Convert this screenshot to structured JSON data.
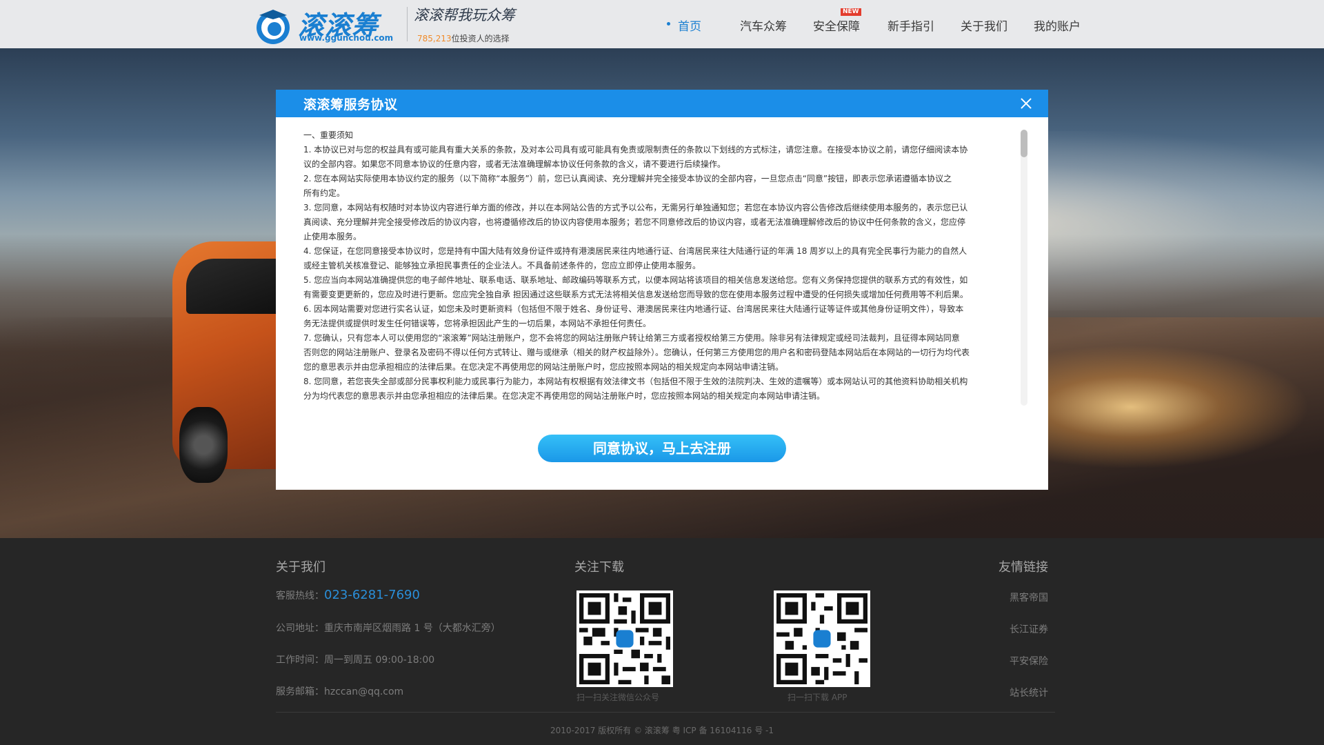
{
  "header": {
    "logo_text": "滚滚筹",
    "logo_url": "www.ggunchou.com",
    "slogan": "滚滚帮我玩众筹",
    "investor_count": "785,213",
    "investor_suffix": "位投资人的选择",
    "nav": [
      {
        "label": "首页",
        "active": true
      },
      {
        "label": "汽车众筹"
      },
      {
        "label": "安全保障",
        "badge": "NEW"
      },
      {
        "label": "新手指引"
      },
      {
        "label": "关于我们"
      },
      {
        "label": "我的账户"
      }
    ]
  },
  "modal": {
    "title": "滚滚筹服务协议",
    "section_title": "一、重要须知",
    "lines": [
      "1. 本协议已对与您的权益具有或可能具有重大关系的条款，及对本公司具有或可能具有免责或限制责任的条款以下划线的方式标注，请您注意。在接受本协议之前，请您仔细阅读本协",
      "议的全部内容。如果您不同意本协议的任意内容，或者无法准确理解本协议任何条款的含义，请不要进行后续操作。",
      "2. 您在本网站实际使用本协议约定的服务（以下简称“本服务”）前，您已认真阅读、充分理解并完全接受本协议的全部内容，一旦您点击“同意”按钮，即表示您承诺遵循本协议之",
      "所有约定。",
      "3. 您同意，本网站有权随时对本协议内容进行单方面的修改，并以在本网站公告的方式予以公布，无需另行单独通知您；若您在本协议内容公告修改后继续使用本服务的，表示您已认",
      "真阅读、充分理解并完全接受修改后的协议内容，也将遵循修改后的协议内容使用本服务；若您不同意修改后的协议内容，或者无法准确理解修改后的协议中任何条款的含义，您应停",
      "止使用本服务。",
      "4. 您保证，在您同意接受本协议时，您是持有中国大陆有效身份证件或持有港澳居民来往内地通行证、台湾居民来往大陆通行证的年满 18 周岁以上的具有完全民事行为能力的自然人",
      "或经主管机关核准登记、能够独立承担民事责任的企业法人。不具备前述条件的，您应立即停止使用本服务。",
      "5. 您应当向本网站准确提供您的电子邮件地址、联系电话、联系地址、邮政编码等联系方式，以便本网站将该项目的相关信息发送给您。您有义务保持您提供的联系方式的有效性，如",
      "有需要变更更新的，您应及时进行更新。您应完全独自承 担因通过这些联系方式无法将相关信息发送给您而导致的您在使用本服务过程中遭受的任何损失或增加任何费用等不利后果。",
      "6. 因本网站需要对您进行实名认证，如您未及时更新资料（包括但不限于姓名、身份证号、港澳居民来往内地通行证、台湾居民来往大陆通行证等证件或其他身份证明文件），导致本",
      "务无法提供或提供时发生任何错误等，您将承担因此产生的一切后果，本网站不承担任何责任。",
      "7. 您确认，只有您本人可以使用您的“滚滚筹”网站注册账户，您不会将您的网站注册账户转让给第三方或者授权给第三方使用。除非另有法律规定或经司法裁判，且征得本网站同意",
      "否则您的网站注册账户、登录名及密码不得以任何方式转让、赠与或继承（相关的财产权益除外）。您确认，任何第三方使用您的用户名和密码登陆本网站后在本网站的一切行为均代表",
      "您的意思表示并由您承担相应的法律后果。在您决定不再使用您的网站注册账户时，您应按照本网站的相关规定向本网站申请注销。",
      "8. 您同意，若您丧失全部或部分民事权利能力或民事行为能力，本网站有权根据有效法律文书（包括但不限于生效的法院判决、生效的遗嘱等）或本网站认可的其他资料协助相关机构",
      "分为均代表您的意思表示并由您承担相应的法律后果。在您决定不再使用您的网站注册账户时，您应按照本网站的相关规定向本网站申请注销。"
    ],
    "agree_button": "同意协议，马上去注册"
  },
  "footer": {
    "about": {
      "title": "关于我们",
      "hotline_label": "客服热线：",
      "hotline": "023-6281-7690",
      "address": "公司地址：重庆市南岸区烟雨路 1 号（大都水汇旁）",
      "hours": "工作时间：周一到周五  09:00-18:00",
      "email": "服务邮箱：hzccan@qq.com"
    },
    "download": {
      "title": "关注下载",
      "qr1_caption": "扫一扫关注微信公众号",
      "qr2_caption": "扫一扫下载 APP"
    },
    "links": {
      "title": "友情链接",
      "items": [
        "黑客帝国",
        "长江证券",
        "平安保险",
        "站长统计"
      ]
    },
    "copyright": "2010-2017 版权所有 © 滚滚筹 粤 ICP 备 16104116 号 -1"
  },
  "colors": {
    "brand_blue": "#1a7fd1",
    "modal_header": "#1b8ee8",
    "accent_orange": "#f08b2a"
  }
}
